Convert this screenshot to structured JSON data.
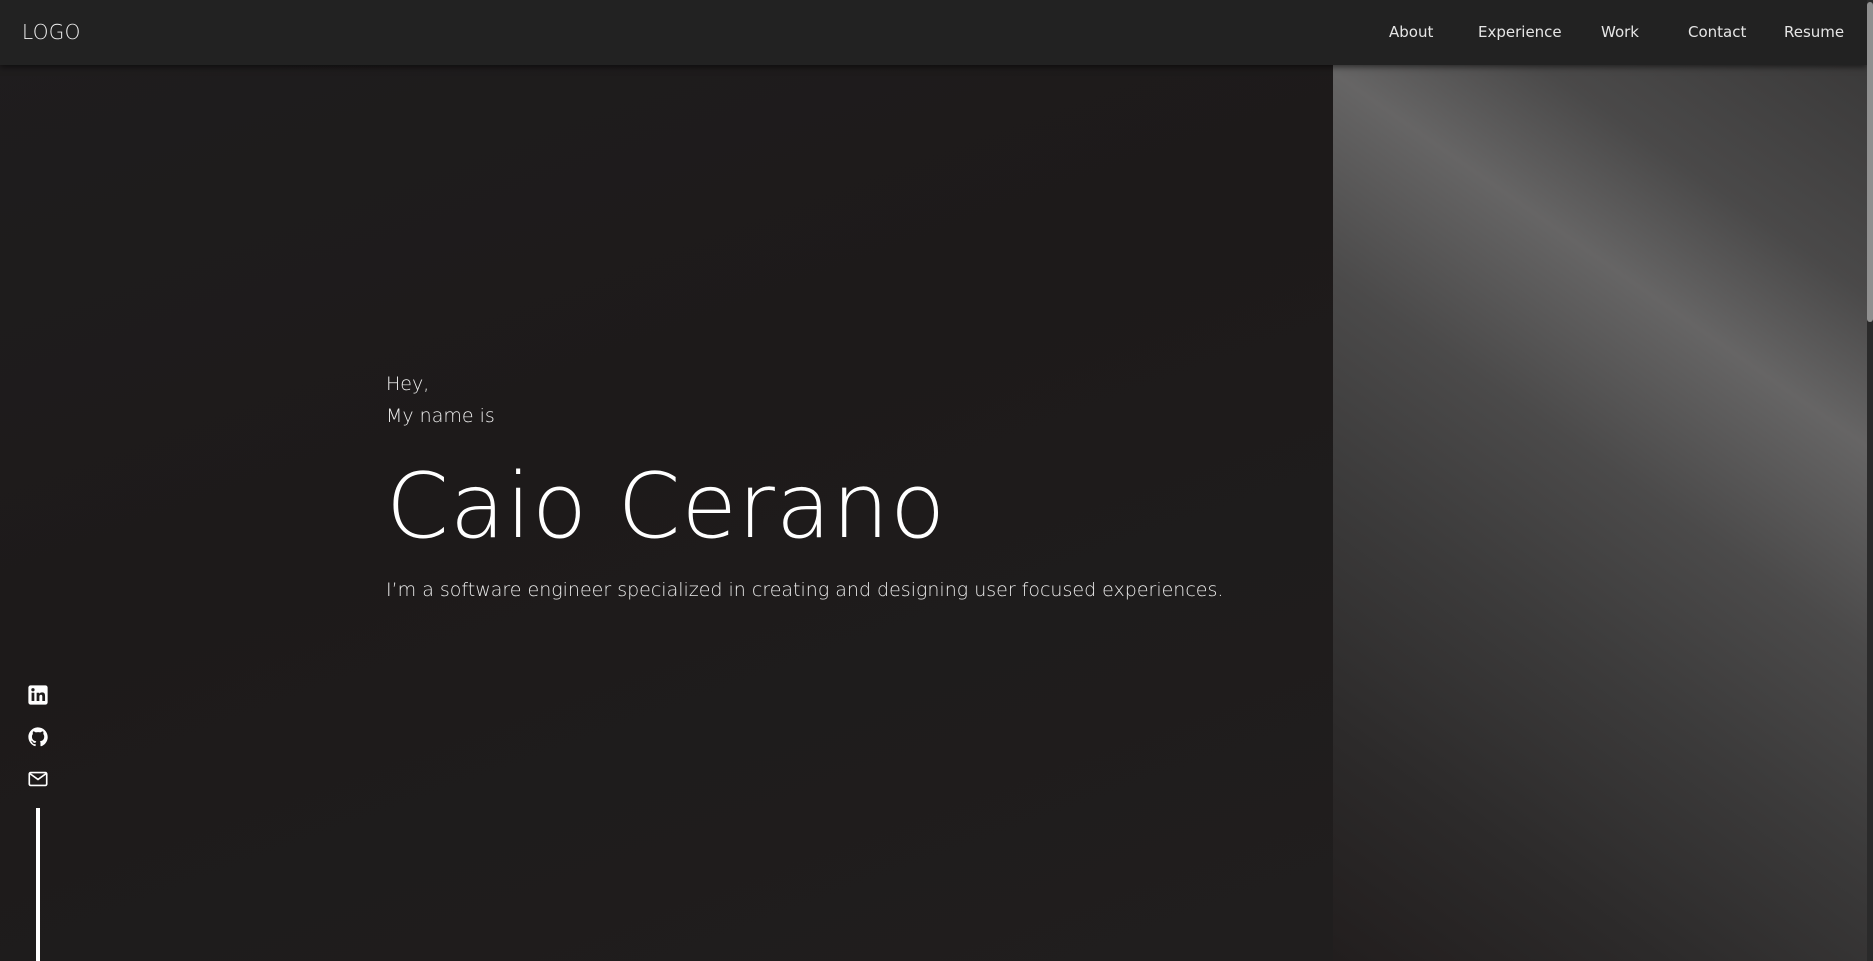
{
  "header": {
    "logo": "LOGO",
    "nav": {
      "about": "About",
      "experience": "Experience",
      "work": "Work",
      "contact": "Contact",
      "resume": "Resume"
    }
  },
  "hero": {
    "greeting_line1": "Hey,",
    "greeting_line2": "My name is",
    "name": "Caio Cerano",
    "tagline": "I’m a software engineer specialized in creating and designing user focused experiences."
  },
  "social": {
    "icons": [
      "linkedin-icon",
      "github-icon",
      "mail-icon"
    ]
  },
  "colors": {
    "background": "#1e1c1c",
    "header": "#222222",
    "text": "#ffffff"
  }
}
